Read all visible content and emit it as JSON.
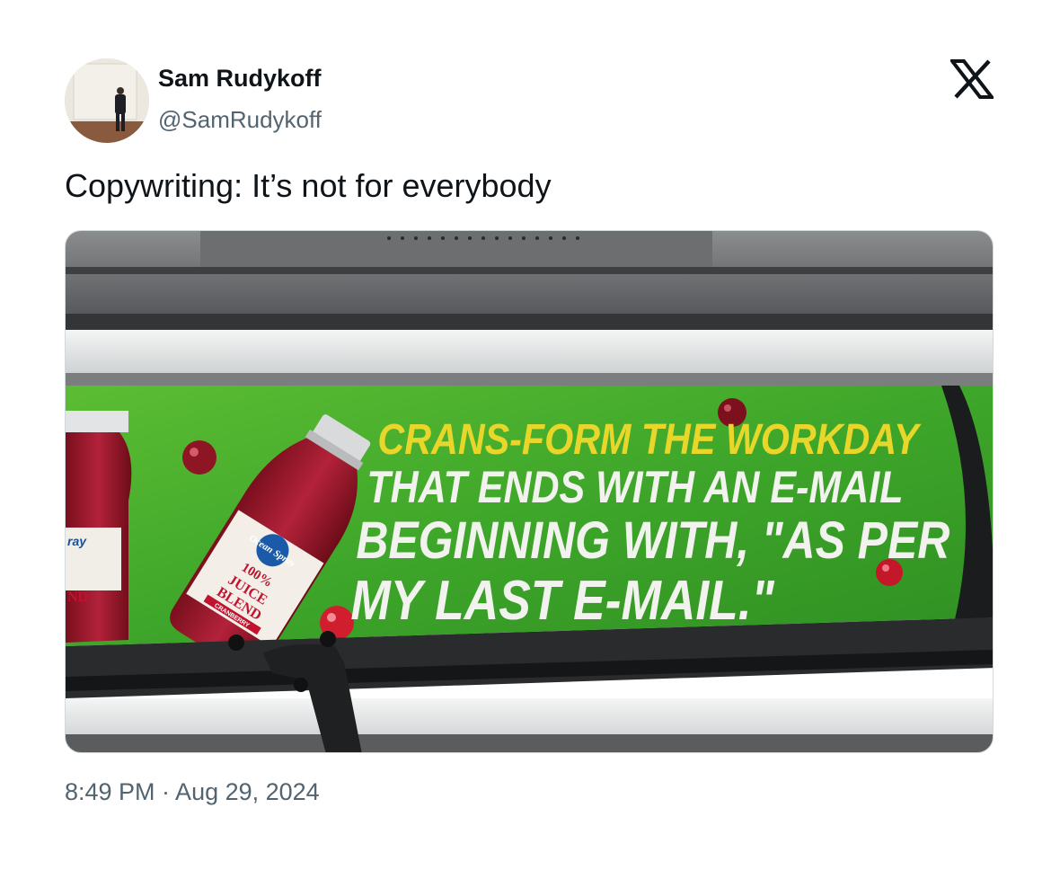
{
  "author": {
    "name": "Sam Rudykoff",
    "handle": "@SamRudykoff"
  },
  "tweet": {
    "text": "Copywriting: It’s not for everybody",
    "timestamp": "8:49 PM · Aug 29, 2024"
  },
  "platform_icon": "x-logo-icon",
  "media": {
    "ad": {
      "headline_lines": [
        "CRANS-FORM THE WORKDAY",
        "THAT ENDS WITH AN E-MAIL",
        "BEGINNING WITH, \"AS PER",
        "MY LAST E-MAIL.\""
      ],
      "brand": "Ocean Spray",
      "bottle_percent": "100%",
      "bottle_label_line1": "JUICE",
      "bottle_label_line2": "BLEND",
      "bottle_flavor": "CRANBERRY",
      "left_bottle_fragment_top": "ray",
      "left_bottle_fragment_bottom": "ND"
    }
  },
  "colors": {
    "text_primary": "#0f1419",
    "text_secondary": "#536471",
    "ad_green": "#3fa52a",
    "headline_yellow": "#e9d62b",
    "headline_white": "#f2f2ee"
  }
}
